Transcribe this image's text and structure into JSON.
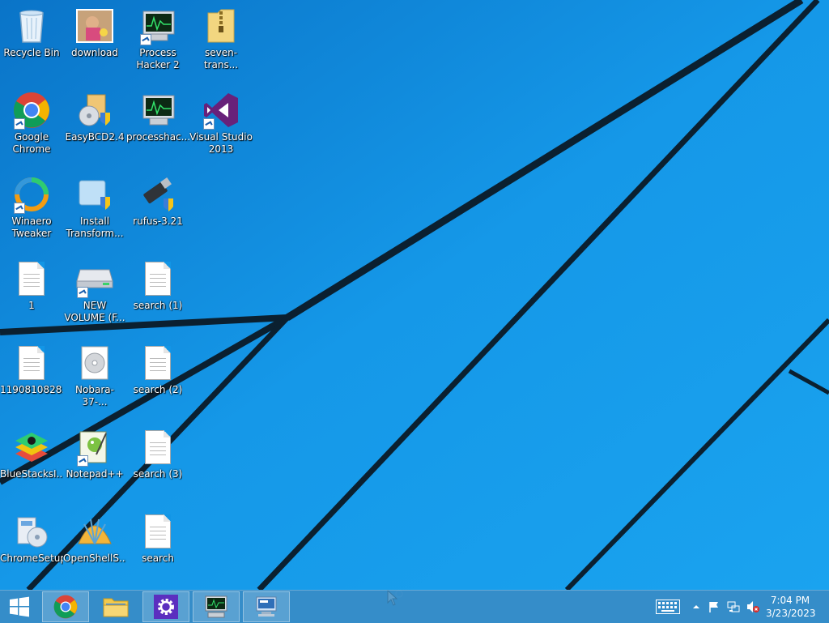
{
  "desktop": {
    "icons": [
      {
        "label": "Recycle Bin",
        "icon": "recycle-bin-icon"
      },
      {
        "label": "download",
        "icon": "image-icon"
      },
      {
        "label": "Process Hacker 2",
        "icon": "process-hacker-icon"
      },
      {
        "label": "seven-trans...",
        "icon": "zip-folder-icon"
      },
      {
        "label": "Google Chrome",
        "icon": "chrome-icon"
      },
      {
        "label": "EasyBCD2.4",
        "icon": "installer-icon"
      },
      {
        "label": "processhac...",
        "icon": "process-hacker-icon"
      },
      {
        "label": "Visual Studio 2013",
        "icon": "visual-studio-icon"
      },
      {
        "label": "Winaero Tweaker",
        "icon": "winaero-icon"
      },
      {
        "label": "Install Transform...",
        "icon": "installer-icon"
      },
      {
        "label": "rufus-3.21",
        "icon": "usb-drive-icon"
      },
      {
        "label": "1",
        "icon": "text-file-icon"
      },
      {
        "label": "NEW VOLUME (F...",
        "icon": "drive-icon"
      },
      {
        "label": "search (1)",
        "icon": "text-file-icon"
      },
      {
        "label": "1190810828...",
        "icon": "text-file-icon"
      },
      {
        "label": "Nobara-37-...",
        "icon": "disc-image-icon"
      },
      {
        "label": "search (2)",
        "icon": "text-file-icon"
      },
      {
        "label": "BlueStacksI...",
        "icon": "bluestacks-icon"
      },
      {
        "label": "Notepad++",
        "icon": "notepadpp-icon"
      },
      {
        "label": "search (3)",
        "icon": "text-file-icon"
      },
      {
        "label": "ChromeSetup",
        "icon": "setup-icon"
      },
      {
        "label": "OpenShellS...",
        "icon": "openshell-icon"
      },
      {
        "label": "search",
        "icon": "text-file-icon"
      }
    ]
  },
  "taskbar": {
    "start_icon": "windows-logo-icon",
    "pinned": [
      {
        "name": "chrome",
        "icon": "chrome-icon"
      },
      {
        "name": "file-explorer",
        "icon": "folder-icon"
      },
      {
        "name": "settings",
        "icon": "gear-icon"
      },
      {
        "name": "task-manager",
        "icon": "monitor-icon"
      },
      {
        "name": "remote-desktop",
        "icon": "remote-desktop-icon"
      }
    ],
    "tray": {
      "keyboard_icon": "keyboard-icon",
      "show_hidden_icon": "chevron-up-icon",
      "flag_icon": "flag-icon",
      "network_icon": "network-icon",
      "volume_icon": "volume-muted-icon"
    },
    "clock": {
      "time": "7:04 PM",
      "date": "3/23/2023"
    }
  },
  "colors": {
    "wallpaper": "#1296e6",
    "taskbar": "#3c8cc3"
  }
}
